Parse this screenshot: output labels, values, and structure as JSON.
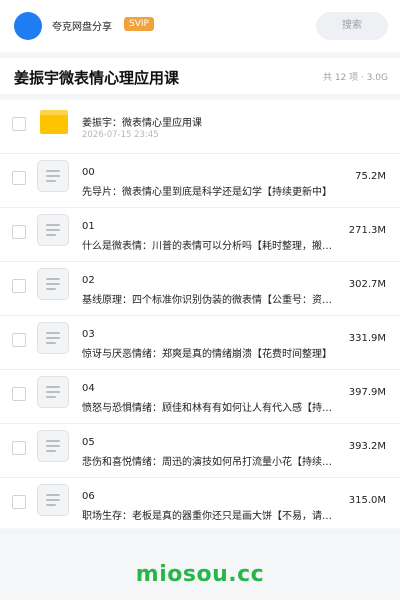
{
  "header": {
    "username": "夸克网盘分享",
    "badge": "SVIP",
    "search_placeholder": "搜索",
    "colors": {
      "avatar": "#1f7cf2",
      "badge": "#f0a23b"
    }
  },
  "folder": {
    "title": "姜振宇微表情心理应用课",
    "meta": "共 12 项 · 3.0G",
    "item_name": "姜振宇：微表情心里应用课",
    "item_date": "2026-07-15 23:45"
  },
  "files": [
    {
      "index": "00",
      "desc": "先导片：微表情心里到底是科学还是幻学【持续更新中】",
      "size": "75.2M"
    },
    {
      "index": "01",
      "desc": "什么是微表情：川普的表情可以分析吗【耗时整理，搬运可耻】",
      "size": "271.3M"
    },
    {
      "index": "02",
      "desc": "基线原理：四个标准你识别伪装的微表情【公重号：资源分享】",
      "size": "302.7M"
    },
    {
      "index": "03",
      "desc": "惊讶与厌恶情绪：郑爽是真的情绪崩溃【花费时间整理】",
      "size": "331.9M"
    },
    {
      "index": "04",
      "desc": "愤怒与恐惧情绪：顾佳和林有有如何让人有代入感【持续更新】",
      "size": "397.9M"
    },
    {
      "index": "05",
      "desc": "悲伤和喜悦情绪：周迅的演技如何吊打流量小花【持续更新】",
      "size": "393.2M"
    },
    {
      "index": "06",
      "desc": "职场生存：老板是真的器重你还只是画大饼【不易，请珍惜】",
      "size": "315.0M"
    }
  ],
  "watermark": {
    "text": "miosou.cc",
    "color": "#2ab54b"
  }
}
